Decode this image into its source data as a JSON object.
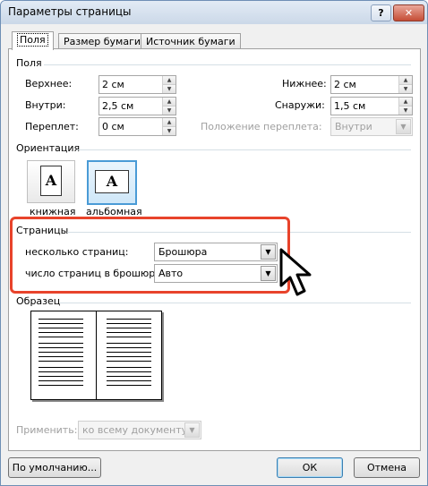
{
  "window": {
    "title": "Параметры страницы",
    "help_label": "?",
    "close_label": "✕"
  },
  "tabs": [
    {
      "label": "Поля",
      "active": true
    },
    {
      "label": "Размер бумаги",
      "active": false
    },
    {
      "label": "Источник бумаги",
      "active": false
    }
  ],
  "margins": {
    "section_label": "Поля",
    "top": {
      "label": "Верхнее:",
      "value": "2 см"
    },
    "bottom": {
      "label": "Нижнее:",
      "value": "2 см"
    },
    "inside": {
      "label": "Внутри:",
      "value": "2,5 см"
    },
    "outside": {
      "label": "Снаружи:",
      "value": "1,5 см"
    },
    "gutter": {
      "label": "Переплет:",
      "value": "0 см"
    },
    "gutter_position": {
      "label": "Положение переплета:",
      "value": "Внутри"
    }
  },
  "orientation": {
    "section_label": "Ориентация",
    "portrait": {
      "label": "книжная",
      "glyph": "A",
      "icon": "portrait-page-icon"
    },
    "landscape": {
      "label": "альбомная",
      "glyph": "A",
      "icon": "landscape-page-icon",
      "selected": true
    }
  },
  "pages": {
    "section_label": "Страницы",
    "multiple": {
      "label": "несколько страниц:",
      "value": "Брошюра"
    },
    "per_booklet": {
      "label": "число страниц в брошюре:",
      "value": "Авто"
    }
  },
  "preview": {
    "section_label": "Образец",
    "icon": "booklet-preview-icon"
  },
  "apply": {
    "label": "Применить:",
    "value": "ко всему документу"
  },
  "buttons": {
    "default_label": "По умолчанию...",
    "ok_label": "ОК",
    "cancel_label": "Отмена"
  },
  "colors": {
    "highlight": "#e8432b",
    "selected_orientation": "#4a9bd6"
  },
  "overlay": {
    "icon": "mouse-cursor-icon"
  }
}
